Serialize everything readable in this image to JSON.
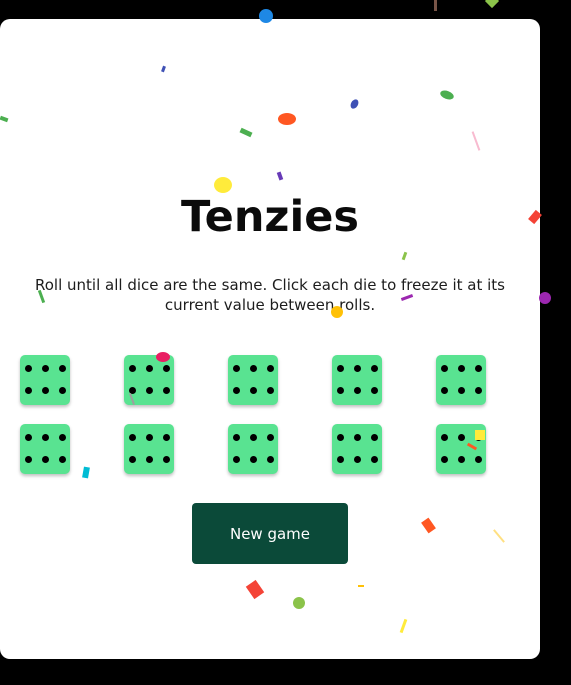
{
  "game": {
    "title": "Tenzies",
    "instructions": "Roll until all dice are the same. Click each die to freeze it at its current value between rolls.",
    "dice": [
      6,
      6,
      6,
      6,
      6,
      6,
      6,
      6,
      6,
      6
    ],
    "button_label": "New game"
  },
  "colors": {
    "background": "#000000",
    "card": "#ffffff",
    "die": "#59e391",
    "button": "#0b4a39"
  }
}
